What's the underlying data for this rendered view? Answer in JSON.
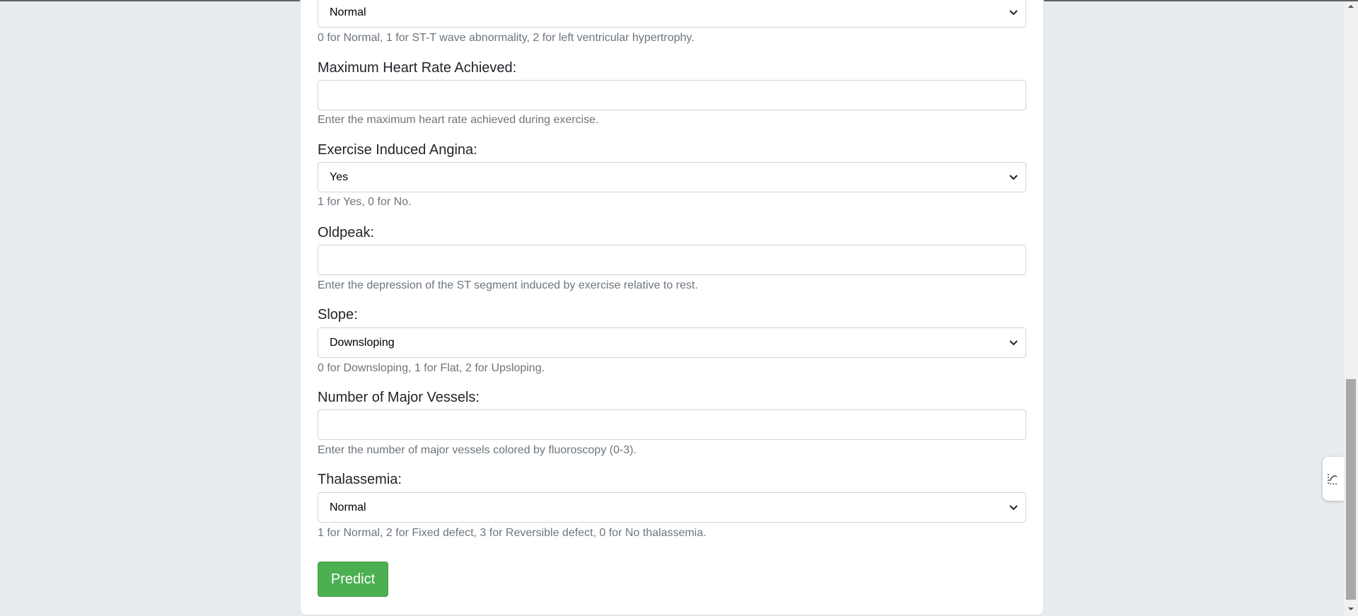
{
  "form": {
    "restecg": {
      "selected": "Normal",
      "help": "0 for Normal, 1 for ST-T wave abnormality, 2 for left ventricular hypertrophy."
    },
    "thalach": {
      "label": "Maximum Heart Rate Achieved:",
      "value": "",
      "help": "Enter the maximum heart rate achieved during exercise."
    },
    "exang": {
      "label": "Exercise Induced Angina:",
      "selected": "Yes",
      "help": "1 for Yes, 0 for No."
    },
    "oldpeak": {
      "label": "Oldpeak:",
      "value": "",
      "help": "Enter the depression of the ST segment induced by exercise relative to rest."
    },
    "slope": {
      "label": "Slope:",
      "selected": "Downsloping",
      "help": "0 for Downsloping, 1 for Flat, 2 for Upsloping."
    },
    "ca": {
      "label": "Number of Major Vessels:",
      "value": "",
      "help": "Enter the number of major vessels colored by fluoroscopy (0-3)."
    },
    "thal": {
      "label": "Thalassemia:",
      "selected": "Normal",
      "help": "1 for Normal, 2 for Fixed defect, 3 for Reversible defect, 0 for No thalassemia."
    },
    "predict_label": "Predict"
  },
  "colors": {
    "page_bg": "#e9ecef",
    "card_bg": "#ffffff",
    "predict_button": "#4caf50",
    "help_text": "#6c757d"
  },
  "icons": {
    "select_arrow": "chevron-down-icon",
    "side_panel": "sidebar-toggle-icon"
  }
}
